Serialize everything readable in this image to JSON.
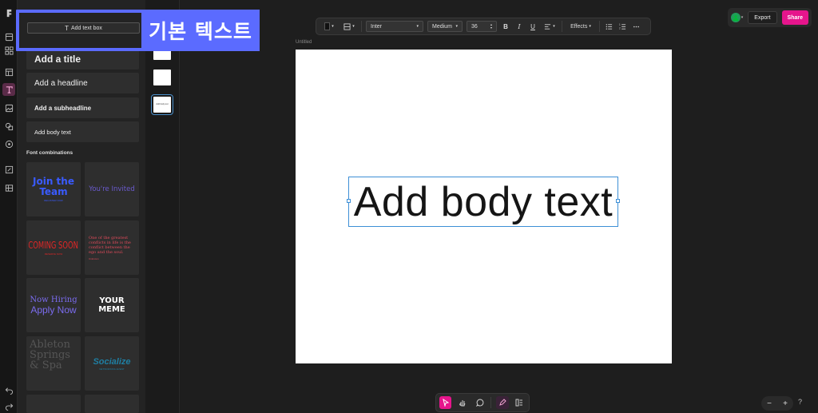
{
  "panel": {
    "add_text_box": "Add text box",
    "presets": [
      {
        "label": "Add a title"
      },
      {
        "label": "Add a headline"
      },
      {
        "label": "Add a subheadline"
      },
      {
        "label": "Add body text"
      }
    ],
    "section_label": "Font combinations",
    "tiles": [
      {
        "lines": [
          "Join the",
          "Team"
        ],
        "sub": "REGISTER NOW"
      },
      {
        "lines": [
          "You're Invited"
        ]
      },
      {
        "lines": [
          "COMING SOON"
        ],
        "sub": "RESERVE NOW"
      },
      {
        "lines": [
          "One of the greatest",
          "conflicts in life is the",
          "conflict between the",
          "ego and the soul."
        ],
        "sub": "Unknown"
      },
      {
        "lines": [
          "Now Hiring",
          "Apply Now"
        ]
      },
      {
        "lines": [
          "YOUR MEME"
        ]
      },
      {
        "lines": [
          "Ableton",
          "Springs",
          "& Spa"
        ]
      },
      {
        "lines": [
          "Socialize"
        ],
        "sub": "NETWORKING EVENT"
      }
    ]
  },
  "pages": {
    "selected_thumb_text": "Add body text"
  },
  "banner": {
    "text": "기본 텍스트"
  },
  "toolbar": {
    "font": "Inter",
    "weight": "Medium",
    "size": "36",
    "bold": "B",
    "italic": "I",
    "underline": "U",
    "effects": "Effects"
  },
  "topright": {
    "export": "Export",
    "share": "Share"
  },
  "canvas": {
    "doc_title": "Untitled",
    "text": "Add body text"
  },
  "zoom": {
    "minus": "−",
    "plus": "+",
    "help": "?"
  },
  "colors": {
    "accent": "#e6158c",
    "selection": "#3d8fd6",
    "banner": "#5b6bff"
  }
}
